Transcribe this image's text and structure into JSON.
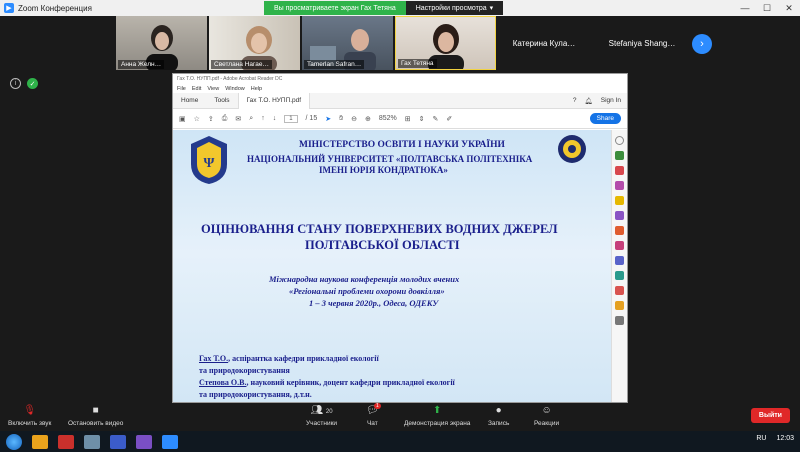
{
  "window": {
    "title": "Zoom Конференция",
    "minimize": "—",
    "maximize": "☐",
    "close": "✕"
  },
  "share_banner": {
    "viewing": "Вы просматриваете экран Гах Тетяна",
    "options": "Настройки просмотра",
    "options_caret": "▾"
  },
  "participants": [
    {
      "name": "Анна Желн…"
    },
    {
      "name": "Светлана Нагае…"
    },
    {
      "name": "Tamerlan Safran…"
    },
    {
      "name": "Гах Тетяна"
    },
    {
      "name": "Катерина  Кула…"
    },
    {
      "name": "Stefaniya  Shang…"
    }
  ],
  "next_arrow": "›",
  "acrobat": {
    "title": "Гах Т.О. НУПП.pdf - Adobe Acrobat Reader DC",
    "menu": [
      "File",
      "Edit",
      "View",
      "Window",
      "Help"
    ],
    "tabs": {
      "home": "Home",
      "tools": "Tools",
      "doc": "Гах Т.О. НУПП.pdf"
    },
    "sign_in": "Sign In",
    "page_current": "1",
    "page_total": "/ 15",
    "zoom": "852%",
    "share": "Share"
  },
  "document": {
    "ministry": "МІНІСТЕРСТВО ОСВІТИ І НАУКИ УКРАЇНИ",
    "university1": "НАЦІОНАЛЬНИЙ УНІВЕРСИТЕТ «ПОЛТАВСЬКА ПОЛІТЕХНІКА",
    "university2": "ІМЕНІ ЮРІЯ КОНДРАТЮКА»",
    "title1": "ОЦІНЮВАННЯ СТАНУ ПОВЕРХНЕВИХ ВОДНИХ ДЖЕРЕЛ",
    "title2": "ПОЛТАВСЬКОЇ ОБЛАСТІ",
    "conf1": "Міжнародна наукова  конференція молодих вчених",
    "conf2": "«Регіональні проблеми охорони довкілля»",
    "conf3": "1 – 3 червня 2020р., Одеса, ОДЕКУ",
    "author1a": "Гах Т.О.",
    "author1b": ", аспірантка кафедри прикладної екології",
    "author1c": "та природокористування",
    "author2a": "Степова О.В.",
    "author2b": ", науковий керівник, доцент кафедри прикладної екології",
    "author2c": "та природокористування, д.т.н."
  },
  "toolbar": {
    "mute": "Включить звук",
    "video": "Остановить видео",
    "participants": "Участники",
    "participants_count": "20",
    "chat": "Чат",
    "chat_badge": "1",
    "share_screen": "Демонстрация экрана",
    "record": "Запись",
    "reactions": "Реакции",
    "leave": "Выйти"
  },
  "taskbar": {
    "lang": "RU",
    "time": "12:03"
  },
  "colors": {
    "zoom_blue": "#2d8cff",
    "share_green": "#2fb34a",
    "leave_red": "#e02828",
    "doc_navy": "#1a1f8c"
  }
}
